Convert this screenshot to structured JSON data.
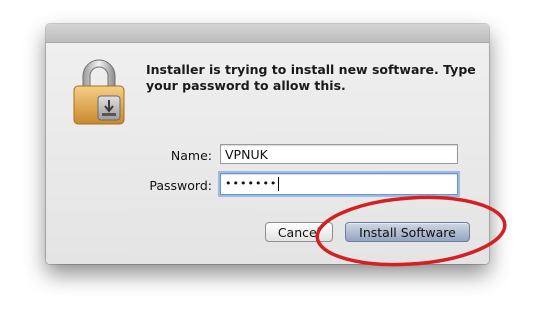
{
  "dialog": {
    "message": "Installer is trying to install new software. Type your password to allow this.",
    "icon": "lock-icon"
  },
  "form": {
    "name_label": "Name:",
    "name_value": "VPNUK",
    "password_label": "Password:",
    "password_value": "•••••••"
  },
  "buttons": {
    "cancel_label": "Cancel",
    "install_label": "Install Software"
  },
  "annotation": {
    "shape": "red-ellipse",
    "color": "#d42020"
  }
}
